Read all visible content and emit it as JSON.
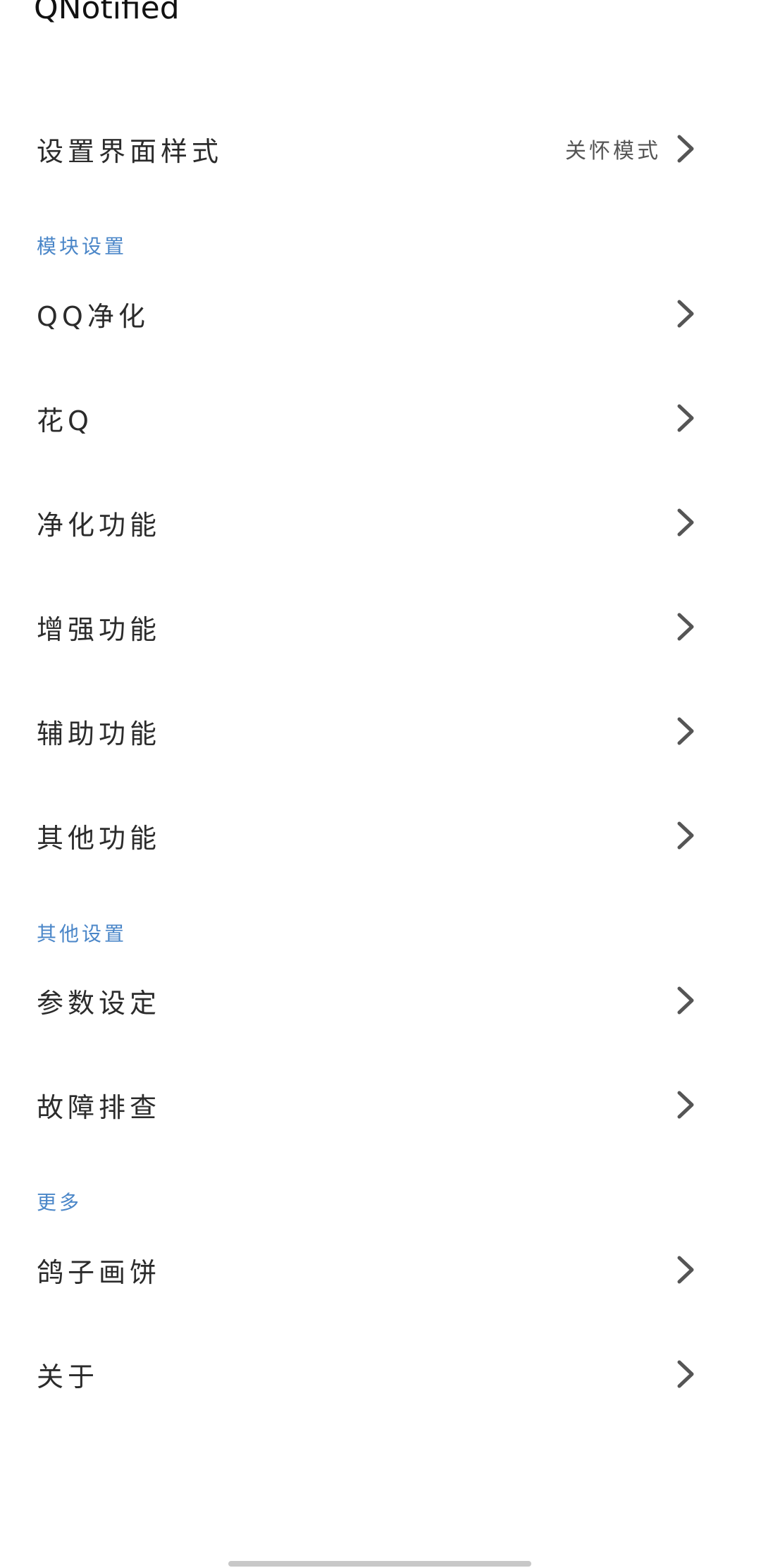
{
  "app": {
    "title": "QNotified"
  },
  "style_setting": {
    "label": "设置界面样式",
    "value": "关怀模式"
  },
  "sections": {
    "modules": {
      "header": "模块设置",
      "items": [
        "QQ净化",
        "花Q",
        "净化功能",
        "增强功能",
        "辅助功能",
        "其他功能"
      ]
    },
    "other": {
      "header": "其他设置",
      "items": [
        "参数设定",
        "故障排查"
      ]
    },
    "more": {
      "header": "更多",
      "items": [
        "鸽子画饼",
        "关于"
      ]
    }
  },
  "icons": {
    "row_chevron": "chevron-right-icon"
  },
  "colors": {
    "background": "#ffffff",
    "section_header": "#4a86c8",
    "text_primary": "#2b2b2b",
    "chevron": "#555555"
  }
}
